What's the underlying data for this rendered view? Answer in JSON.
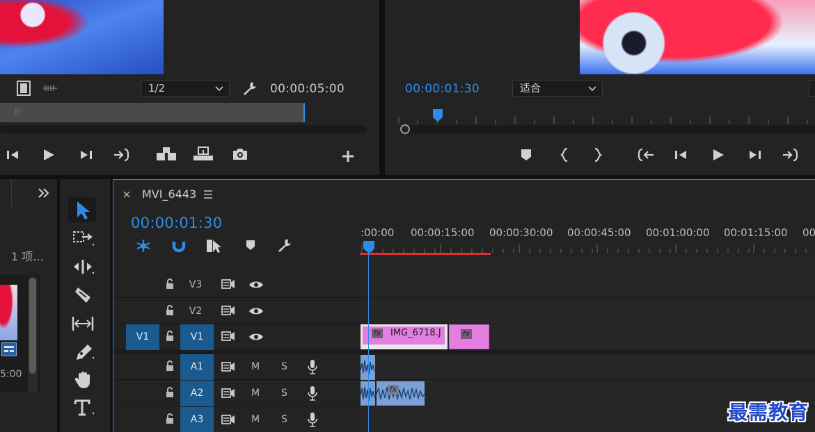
{
  "source_monitor": {
    "zoom": "1/2",
    "timecode": "00:00:05:00"
  },
  "program_monitor": {
    "timecode": "00:00:01:30",
    "fit": "适合"
  },
  "project_panel": {
    "item_count": "1 项...",
    "thumb_duration": "5:00"
  },
  "timeline": {
    "sequence_name": "MVI_6443",
    "timecode": "00:00:01:30",
    "ruler": [
      ":00:00",
      "00:00:15:00",
      "00:00:30:00",
      "00:00:45:00",
      "00:01:00:00",
      "00:01:15:00"
    ],
    "video_tracks": [
      {
        "name": "V3",
        "source": ""
      },
      {
        "name": "V2",
        "source": ""
      },
      {
        "name": "V1",
        "source": "V1"
      }
    ],
    "audio_tracks": [
      {
        "name": "A1",
        "m": "M",
        "s": "S"
      },
      {
        "name": "A2",
        "m": "M",
        "s": "S"
      },
      {
        "name": "A3",
        "m": "M",
        "s": "S"
      }
    ],
    "clips": {
      "video_clip_1": "IMG_6718.J",
      "fx": "fx"
    }
  },
  "watermark": "最需教育",
  "colors": {
    "accent_blue": "#2d8ceb",
    "clip_pink": "#e27fe0",
    "audio_clip": "#7aa0d8",
    "work_area_red": "#e03030"
  }
}
